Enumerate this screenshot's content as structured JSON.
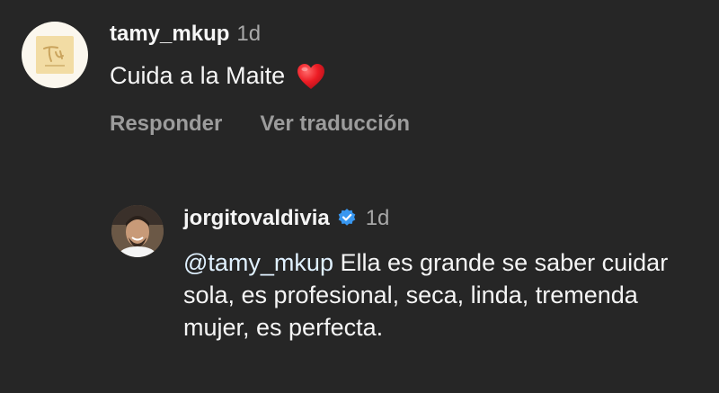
{
  "comment": {
    "username": "tamy_mkup",
    "time": "1d",
    "text": "Cuida a la Maite",
    "emoji_icon": "red-heart-icon",
    "actions": {
      "reply": "Responder",
      "translate": "Ver traducción"
    }
  },
  "reply": {
    "username": "jorgitovaldivia",
    "verified_icon": "verified-badge-icon",
    "time": "1d",
    "mention": "@tamy_mkup",
    "text": " Ella es grande se saber cuidar sola, es profesional, seca, linda, tremenda mujer, es perfecta."
  },
  "colors": {
    "background": "#262626",
    "text": "#f5f5f5",
    "secondary": "#a8a8a8",
    "verified": "#3897f0",
    "heart": "#ed1c24"
  }
}
